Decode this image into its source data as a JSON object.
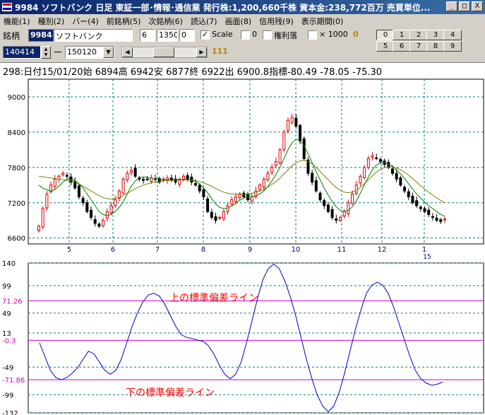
{
  "window": {
    "title": "9984 ソフトバンク  日足  東証一部･情報･通信業  発行株:1,200,660千株  資本金:238,772百万  売買単位...",
    "buttons": [
      "_",
      "□",
      "X"
    ]
  },
  "menu": [
    "機能(1)",
    "種別(2)",
    "バー(4)",
    "前銘柄(5)",
    "次銘柄(6)",
    "読込(7)",
    "画面(8)",
    "信用残(9)",
    "表示期間(0)"
  ],
  "toolbar": {
    "symbol_label": "銘柄",
    "code": "9984",
    "name": "ソフトバンク",
    "field_a": "6",
    "field_b": "1350",
    "field_c": "0",
    "scale_label": "Scale",
    "scale_checked": "✓",
    "zero_label": "0",
    "rights_label": "権利落",
    "x1000_label": "× 1000",
    "yellow_zero": "0",
    "number_buttons": [
      "0",
      "1",
      "2",
      "3",
      "4",
      "5",
      "6",
      "7",
      "8",
      "9"
    ],
    "date_from": "140414",
    "date_to": "150120",
    "dash": "ー",
    "bars_count": "111"
  },
  "info": {
    "text": "298:日付15/01/20始 6894高 6942安 6877終 6922出 6900.8指標-80.49  -78.05  -75.30"
  },
  "price_axis": [
    "9000",
    "8400",
    "7800",
    "7200",
    "6600"
  ],
  "month_labels": [
    "5",
    "6",
    "7",
    "8",
    "9",
    "10",
    "11",
    "12",
    "1"
  ],
  "month_sub": "15",
  "indicator_axis": [
    "140",
    "99",
    "71.26",
    "49",
    "13",
    "-0.3",
    "-49",
    "-71.86",
    "-99",
    "-132"
  ],
  "annotations": {
    "upper": "上の標準偏差ライン",
    "lower": "下の標準偏差ライン"
  },
  "colors": {
    "up_candle": "#dd0000",
    "down_candle": "#000000",
    "ma_short": "#008000",
    "ma_long": "#808000",
    "indicator": "#0000cc",
    "sd_line": "#cc00cc",
    "grid": "#008080",
    "annotation": "#ff0000"
  },
  "chart_data": [
    {
      "type": "candlestick",
      "ylim": [
        6500,
        9300
      ],
      "x_label_months": [
        "5",
        "6",
        "7",
        "8",
        "9",
        "10",
        "11",
        "12",
        "1"
      ],
      "close": [
        6800,
        7100,
        7350,
        7500,
        7600,
        7650,
        7700,
        7650,
        7550,
        7450,
        7300,
        7200,
        7050,
        6950,
        6850,
        6800,
        6900,
        7050,
        7150,
        7250,
        7400,
        7600,
        7700,
        7750,
        7650,
        7600,
        7580,
        7600,
        7620,
        7600,
        7550,
        7600,
        7620,
        7580,
        7550,
        7600,
        7650,
        7600,
        7550,
        7500,
        7400,
        7300,
        7050,
        6950,
        6900,
        6950,
        7050,
        7150,
        7250,
        7300,
        7350,
        7300,
        7250,
        7300,
        7400,
        7500,
        7600,
        7700,
        7800,
        7900,
        8100,
        8400,
        8600,
        8650,
        8500,
        8250,
        7950,
        7700,
        7550,
        7400,
        7250,
        7150,
        7050,
        6950,
        6900,
        6950,
        7050,
        7200,
        7350,
        7500,
        7650,
        7800,
        7950,
        8000,
        7950,
        7900,
        7850,
        7800,
        7700,
        7600,
        7500,
        7400,
        7300,
        7200,
        7150,
        7100,
        7050,
        7000,
        6950,
        6900,
        6880,
        6922
      ],
      "ma_short": [
        7500,
        7450,
        7420,
        7400,
        7420,
        7480,
        7550,
        7600,
        7600,
        7580,
        7520,
        7450,
        7350,
        7250,
        7150,
        7050,
        7000,
        6980,
        7000,
        7050,
        7120,
        7220,
        7350,
        7480,
        7570,
        7620,
        7640,
        7630,
        7620,
        7610,
        7600,
        7590,
        7590,
        7590,
        7590,
        7590,
        7600,
        7600,
        7590,
        7560,
        7520,
        7450,
        7370,
        7270,
        7180,
        7120,
        7100,
        7110,
        7140,
        7190,
        7240,
        7280,
        7300,
        7300,
        7320,
        7350,
        7400,
        7480,
        7570,
        7680,
        7800,
        7950,
        8100,
        8220,
        8280,
        8260,
        8170,
        8030,
        7880,
        7730,
        7590,
        7450,
        7330,
        7220,
        7130,
        7070,
        7050,
        7070,
        7130,
        7230,
        7360,
        7500,
        7640,
        7760,
        7840,
        7880,
        7880,
        7860,
        7820,
        7760,
        7690,
        7610,
        7520,
        7430,
        7350,
        7280,
        7210,
        7150,
        7100,
        7050,
        7000,
        6970
      ],
      "ma_long": [
        7650,
        7640,
        7630,
        7620,
        7610,
        7600,
        7590,
        7580,
        7570,
        7550,
        7520,
        7480,
        7440,
        7400,
        7360,
        7320,
        7290,
        7270,
        7260,
        7270,
        7290,
        7320,
        7360,
        7400,
        7440,
        7470,
        7500,
        7520,
        7540,
        7550,
        7560,
        7570,
        7580,
        7585,
        7590,
        7590,
        7590,
        7590,
        7585,
        7575,
        7560,
        7540,
        7510,
        7480,
        7440,
        7410,
        7380,
        7360,
        7350,
        7340,
        7340,
        7340,
        7350,
        7360,
        7380,
        7400,
        7430,
        7470,
        7510,
        7560,
        7620,
        7690,
        7760,
        7830,
        7880,
        7910,
        7920,
        7900,
        7860,
        7800,
        7730,
        7660,
        7590,
        7520,
        7460,
        7410,
        7380,
        7370,
        7380,
        7410,
        7460,
        7520,
        7590,
        7660,
        7720,
        7770,
        7800,
        7810,
        7810,
        7790,
        7760,
        7720,
        7670,
        7610,
        7550,
        7490,
        7430,
        7380,
        7330,
        7280,
        7240,
        7200
      ]
    },
    {
      "type": "line",
      "ylim": [
        -132,
        140
      ],
      "upper_band": 71.26,
      "lower_band": -71.86,
      "center": -0.3,
      "values": [
        -5,
        -30,
        -55,
        -68,
        -72,
        -68,
        -60,
        -50,
        -35,
        -20,
        -25,
        -40,
        -55,
        -62,
        -55,
        -35,
        -5,
        25,
        50,
        70,
        82,
        85,
        80,
        65,
        45,
        25,
        10,
        5,
        3,
        0,
        -2,
        -10,
        -25,
        -45,
        -62,
        -70,
        -62,
        -40,
        -5,
        35,
        75,
        110,
        130,
        138,
        130,
        108,
        80,
        45,
        5,
        -35,
        -70,
        -100,
        -120,
        -130,
        -120,
        -95,
        -60,
        -20,
        20,
        55,
        85,
        100,
        105,
        100,
        85,
        60,
        30,
        0,
        -30,
        -55,
        -70,
        -78,
        -82,
        -80,
        -76
      ]
    }
  ]
}
